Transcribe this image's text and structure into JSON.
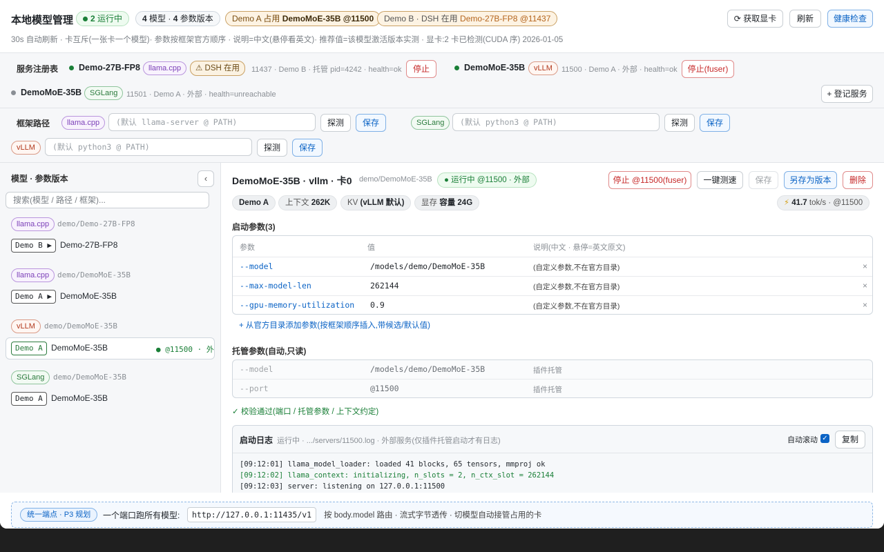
{
  "header": {
    "title": "本地模型管理",
    "running_count": "2",
    "running_label": "运行中",
    "models_count": "4",
    "models_label": "模型 ·",
    "versions_count": "4",
    "versions_label": "参数版本",
    "demo_a_prefix": "Demo A 占用",
    "demo_a_value": "DemoMoE-35B @11500",
    "demo_b_prefix": "Demo B · DSH 在用",
    "demo_b_value": "Demo-27B-FP8 @11437",
    "get_gpu": "获取显卡",
    "refresh": "刷新",
    "health_check": "健康检查",
    "subline": "30s 自动刷新 · 卡互斥(一张卡一个模型)· 参数按框架官方顺序 · 说明=中文(悬停看英文)· 推荐值=该模型激活版本实测 · 显卡:2 卡已检测(CUDA 序) 2026-01-05"
  },
  "registry": {
    "label": "服务注册表",
    "services": [
      {
        "name": "Demo-27B-FP8",
        "framework": "llama.cpp",
        "badge": "DSH 在用",
        "meta": "11437 · Demo B · 托管 pid=4242 · health=ok",
        "action": "停止"
      },
      {
        "name": "DemoMoE-35B",
        "framework": "vLLM",
        "meta": "11500 · Demo A · 外部 · health=ok",
        "action": "停止(fuser)"
      },
      {
        "name": "DemoMoE-35B",
        "framework": "SGLang",
        "meta": "11501 · Demo A · 外部 · health=unreachable"
      }
    ],
    "register_button": "+ 登记服务"
  },
  "frameworks": {
    "label": "框架路径",
    "items": [
      {
        "name": "llama.cpp",
        "placeholder": "(默认 llama-server @ PATH)"
      },
      {
        "name": "SGLang",
        "placeholder": "(默认 python3 @ PATH)"
      },
      {
        "name": "vLLM",
        "placeholder": "(默认 python3 @ PATH)"
      }
    ],
    "probe": "探测",
    "save": "保存"
  },
  "sidebar": {
    "title": "模型 · 参数版本",
    "collapse_glyph": "‹",
    "search_placeholder": "搜索(模型 / 路径 / 框架)...",
    "groups": [
      {
        "framework": "llama.cpp",
        "path": "demo/Demo-27B-FP8",
        "version": "Demo B ▶",
        "model": "Demo-27B-FP8"
      },
      {
        "framework": "llama.cpp",
        "path": "demo/DemoMoE-35B",
        "version": "Demo A ▶",
        "model": "DemoMoE-35B"
      },
      {
        "framework": "vLLM",
        "path": "demo/DemoMoE-35B",
        "version": "Demo A",
        "model": "DemoMoE-35B",
        "status": "● @11500 · 外"
      },
      {
        "framework": "SGLang",
        "path": "demo/DemoMoE-35B",
        "version": "Demo A",
        "model": "DemoMoE-35B"
      }
    ]
  },
  "detail": {
    "title": "DemoMoE-35B · vllm · 卡0",
    "path": "demo/DemoMoE-35B",
    "status": "● 运行中 @11500 · 外部",
    "stop": "停止 @11500(fuser)",
    "speed_test": "一键测速",
    "save": "保存",
    "save_as": "另存为版本",
    "delete": "删除",
    "chips": {
      "demo": "Demo A",
      "ctx_label": "上下文",
      "ctx_value": "262K",
      "kv_label": "KV",
      "kv_value": "(vLLM 默认)",
      "mem_label": "显存",
      "mem_value": "容量 24G"
    },
    "perf": {
      "icon": "⚡",
      "value": "41.7",
      "unit": "tok/s · @11500"
    },
    "launch_title": "启动参数(3)",
    "cols": {
      "param": "参数",
      "value": "值",
      "desc": "说明(中文 · 悬停=英文原文)"
    },
    "params": [
      {
        "key": "--model",
        "value": "/models/demo/DemoMoE-35B",
        "desc": "(自定义参数,不在官方目录)"
      },
      {
        "key": "--max-model-len",
        "value": "262144",
        "desc": "(自定义参数,不在官方目录)"
      },
      {
        "key": "--gpu-memory-utilization",
        "value": "0.9",
        "desc": "(自定义参数,不在官方目录)"
      }
    ],
    "remove_glyph": "×",
    "add_link": "+ 从官方目录添加参数(按框架顺序插入,带候选/默认值)",
    "managed_title": "托管参数(自动,只读)",
    "managed": [
      {
        "key": "--model",
        "value": "/models/demo/DemoMoE-35B",
        "desc": "插件托管"
      },
      {
        "key": "--port",
        "value": "@11500",
        "desc": "插件托管"
      }
    ],
    "validation": "✓ 校验通过(端口 / 托管参数 / 上下文约定)",
    "log": {
      "title": "启动日志",
      "meta": "运行中 · .../servers/11500.log · 外部服务(仅插件托管启动才有日志)",
      "autoscroll": "自动滚动",
      "copy": "复制",
      "lines": [
        "[09:12:01] llama_model_loader: loaded 41 blocks, 65 tensors, mmproj ok",
        "[09:12:02] llama_context: initializing, n_slots = 2, n_ctx_slot = 262144",
        "[09:12:03] server: listening on 127.0.0.1:11500"
      ]
    }
  },
  "footer": {
    "badge": "统一端点 · P3 规划",
    "label": "一个端口跑所有模型:",
    "url": "http://127.0.0.1:11435/v1",
    "desc": "按 body.model 路由 · 流式字节透传 · 切模型自动接管占用的卡"
  },
  "colors": {
    "accent": "#0b63c5",
    "ok": "#1a7f37",
    "danger": "#c62828",
    "warn": "#b5651d"
  }
}
